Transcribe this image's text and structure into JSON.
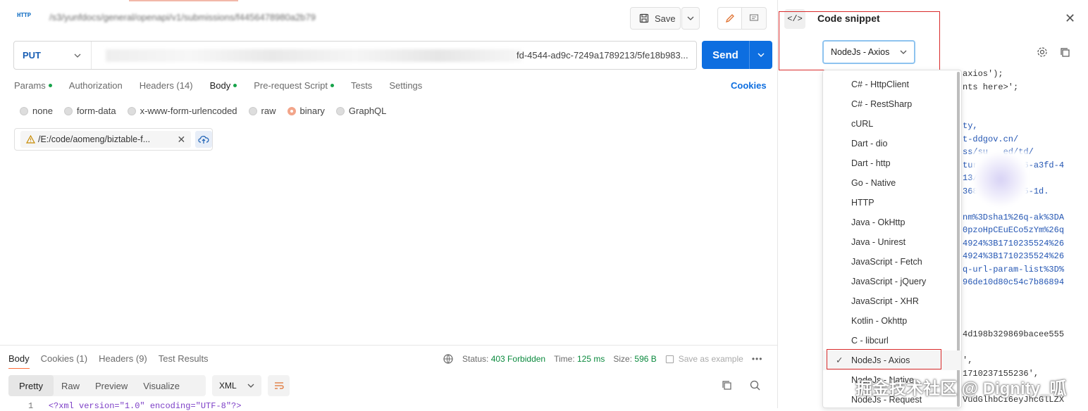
{
  "header": {
    "http_badge": "HTTP",
    "request_path": "/s3/yunfdocs/general/openapi/v1/submissions/f4456478980a2b79"
  },
  "toolbar": {
    "save_label": "Save"
  },
  "request": {
    "method": "PUT",
    "url_suffix": "fd-4544-ad9c-7249a1789213/5fe18b983...",
    "send_label": "Send"
  },
  "request_tabs": [
    {
      "label": "Params",
      "dot": true
    },
    {
      "label": "Authorization",
      "dot": false
    },
    {
      "label": "Headers (14)",
      "dot": false
    },
    {
      "label": "Body",
      "dot": true,
      "active": true
    },
    {
      "label": "Pre-request Script",
      "dot": true
    },
    {
      "label": "Tests",
      "dot": false
    },
    {
      "label": "Settings",
      "dot": false
    }
  ],
  "cookies_label": "Cookies",
  "body_options": [
    {
      "label": "none",
      "selected": false
    },
    {
      "label": "form-data",
      "selected": false
    },
    {
      "label": "x-www-form-urlencoded",
      "selected": false
    },
    {
      "label": "raw",
      "selected": false
    },
    {
      "label": "binary",
      "selected": true
    },
    {
      "label": "GraphQL",
      "selected": false
    }
  ],
  "file": {
    "path": "/E:/code/aomeng/biztable-f..."
  },
  "response": {
    "tabs": [
      {
        "label": "Body",
        "active": true
      },
      {
        "label": "Cookies (1)"
      },
      {
        "label": "Headers (9)"
      },
      {
        "label": "Test Results"
      }
    ],
    "status_label": "Status:",
    "status_value": "403 Forbidden",
    "time_label": "Time:",
    "time_value": "125 ms",
    "size_label": "Size:",
    "size_value": "596 B",
    "save_example_label": "Save as example",
    "format_tabs": [
      "Pretty",
      "Raw",
      "Preview",
      "Visualize"
    ],
    "format_select": "XML",
    "line_number": "1",
    "code_line": "<?xml version=\"1.0\" encoding=\"UTF-8\"?>"
  },
  "snippet": {
    "title": "Code snippet",
    "selected_language": "NodeJs - Axios",
    "code_lines": [
      "axios');",
      "nts here>';",
      "",
      "",
      "ty,",
      "t-ddgov.cn/",
      "ss/su   ed/td/",
      "ture   b7/6e6-a3fd-4",
      "13/",
      "368    732d95-1d.",
      "",
      "nm%3Dsha1%26q-ak%3DA",
      "0pzoHpCEuECo5zYm%26q",
      "4924%3B1710235524%26",
      "4924%3B1710235524%26",
      "q-url-param-list%3D%",
      "96de10d80c54c7b86894",
      "",
      "",
      "",
      "4d198b329869bacee555",
      "",
      "',",
      "1710237155236',",
      "",
      "VudGlhbCI6eyJhcGlLZX"
    ],
    "languages": [
      "C# - HttpClient",
      "C# - RestSharp",
      "cURL",
      "Dart - dio",
      "Dart - http",
      "Go - Native",
      "HTTP",
      "Java - OkHttp",
      "Java - Unirest",
      "JavaScript - Fetch",
      "JavaScript - jQuery",
      "JavaScript - XHR",
      "Kotlin - Okhttp",
      "C - libcurl",
      "NodeJs - Axios",
      "NodeJs - Native",
      "NodeJs - Request"
    ]
  },
  "watermark": "掘金技术社区 @ Dignity_呱"
}
